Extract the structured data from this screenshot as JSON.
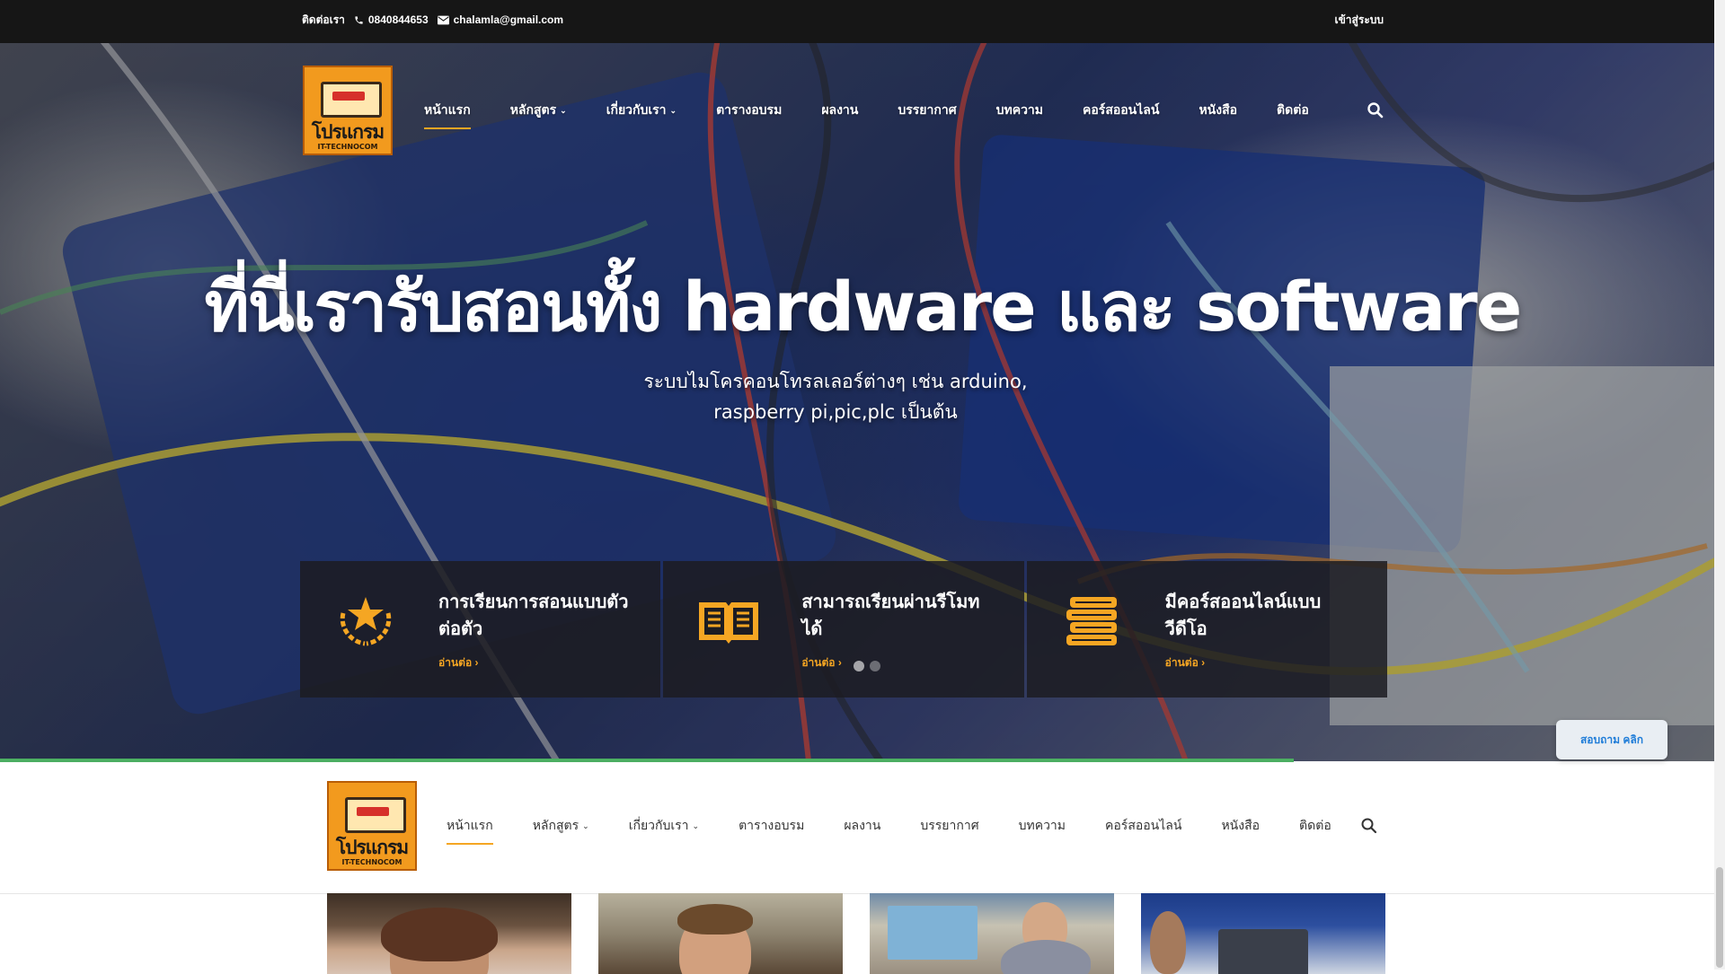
{
  "topbar": {
    "contact_label": "ติดต่อเรา",
    "phone": "0840844653",
    "email": "chalamla@gmail.com",
    "login": "เข้าสู่ระบบ"
  },
  "logo": {
    "brand": "โปรแกรม",
    "sub": "IT-TECHNOCOM"
  },
  "nav": {
    "items": [
      {
        "label": "หน้าแรก",
        "active": true
      },
      {
        "label": "หลักสูตร",
        "dropdown": true
      },
      {
        "label": "เกี่ยวกับเรา",
        "dropdown": true
      },
      {
        "label": "ตารางอบรม"
      },
      {
        "label": "ผลงาน"
      },
      {
        "label": "บรรยากาศ"
      },
      {
        "label": "บทความ"
      },
      {
        "label": "คอร์สออนไลน์"
      },
      {
        "label": "หนังสือ"
      },
      {
        "label": "ติดต่อ"
      }
    ],
    "search_icon": "search-icon",
    "dropdown_icon": "chevron-down-icon"
  },
  "hero": {
    "headline": "ที่นี่เรารับสอนทั้ง hardware และ software",
    "subline_1": "ระบบไมโครคอนโทรลเลอร์ต่างๆ เช่น arduino,",
    "subline_2": "raspberry pi,pic,plc เป็นต้น",
    "features": [
      {
        "title": "การเรียนการสอนแบบตัวต่อตัว",
        "more": "อ่านต่อ",
        "icon": "award-star-icon"
      },
      {
        "title": "สามารถเรียนผ่านรีโมทได้",
        "more": "อ่านต่อ",
        "icon": "open-book-icon"
      },
      {
        "title": "มีคอร์สออนไลน์แบบวีดีโอ",
        "more": "อ่านต่อ",
        "icon": "books-stack-icon"
      }
    ],
    "slider_dots": 2
  },
  "chat": {
    "label": "สอบถาม คลิก"
  },
  "colors": {
    "accent": "#f5a623",
    "topbar": "#161616",
    "progress": "#4caf62",
    "chat_text": "#1e7cd8"
  }
}
